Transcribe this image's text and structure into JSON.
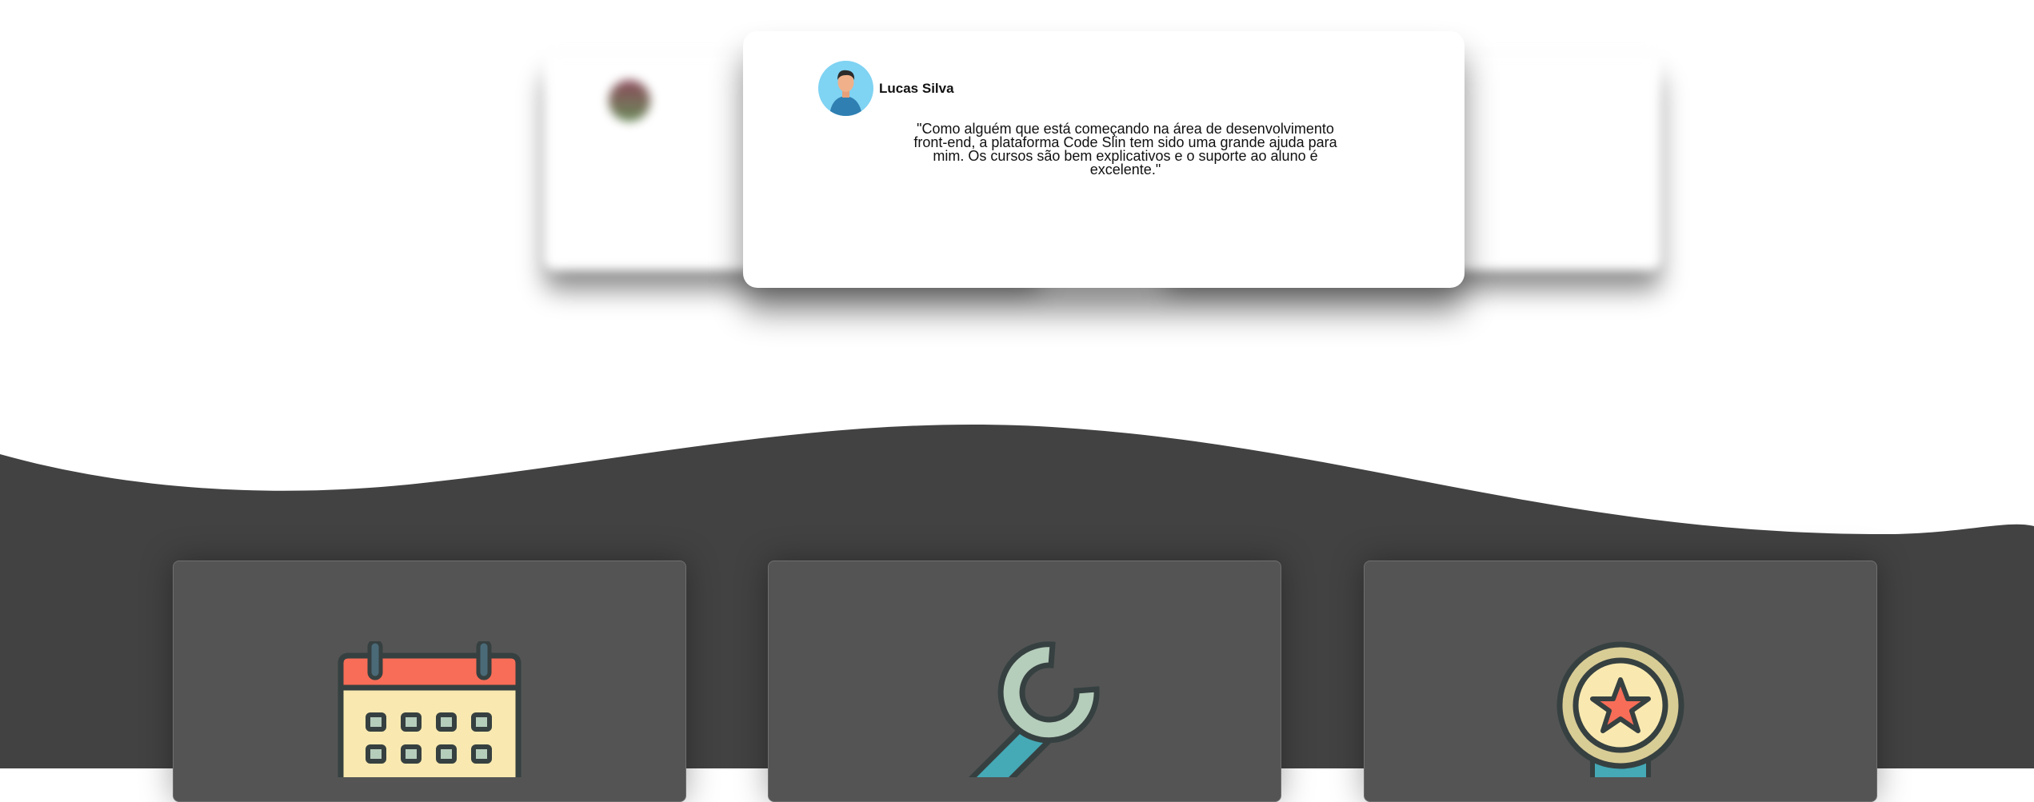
{
  "testimonials": {
    "active": {
      "name": "Lucas Silva",
      "quote": "\"Como alguém que está começando na área de desenvolvimento front-end, a plataforma Code Slin tem sido uma grande ajuda para mim. Os cursos são bem explicativos e o suporte ao aluno é excelente.\""
    }
  },
  "features": [
    {
      "icon": "calendar-icon"
    },
    {
      "icon": "wrench-icon"
    },
    {
      "icon": "medal-icon"
    }
  ],
  "colors": {
    "dark_section": "#424242",
    "feature_card": "#545454",
    "accent_red": "#f76d57",
    "accent_teal": "#45a9b6"
  }
}
